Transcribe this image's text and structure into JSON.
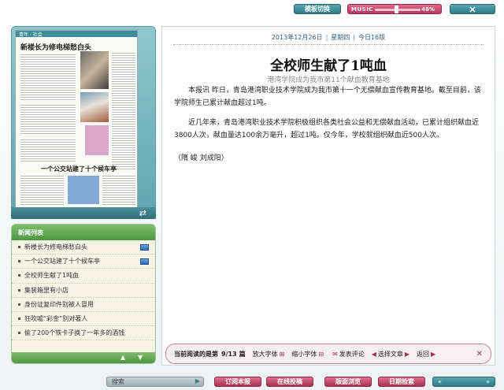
{
  "topbar": {
    "mode_switch_label": "模板切换",
    "music_label": "MUSIC",
    "music_volume": "46%",
    "music_volume_fraction": 0.46
  },
  "thumbnail": {
    "band_label": "青年 · 社会",
    "headline_1": "新楼长为修电梯愁白头",
    "headline_2": "一个公交站建了十个候车亭",
    "refresh_icon": "refresh-icon"
  },
  "news_list": {
    "title": "新闻列表",
    "items": [
      {
        "label": "新楼长为修电梯愁白头",
        "has_image": true
      },
      {
        "label": "一个公交站建了十个候车亭",
        "has_image": true
      },
      {
        "label": "全校师生献了1吨血",
        "has_image": false
      },
      {
        "label": "集装箱里有小店",
        "has_image": false
      },
      {
        "label": "身份证复印件别被人冒用",
        "has_image": false
      },
      {
        "label": "狂吹嘘“彩金”别对著人",
        "has_image": false
      },
      {
        "label": "偷了200个铁卡子换了一年多的酒钱",
        "has_image": false
      }
    ]
  },
  "article": {
    "date": "2013年12月26日",
    "weekday": "星期四",
    "edition": "今日16版",
    "title": "全校师生献了1吨血",
    "subtitle": "港湾学院成为我市第11个献血教育基地",
    "paragraph_1": "本报讯 昨日，青岛港湾职业技术学院成为我市第十一个无偿献血宣传教育基地。截至目前，该学院师生已累计献血超过1吨。",
    "paragraph_2": "近几年来，青岛港湾职业技术学院积极组织各类社会公益和无偿献血活动，已累计组织献血近 3800人次，献血量达100余万毫升，超过1吨。仅今年，学校就组织献血近500人次。",
    "author": "（隋 峻 刘成阳）"
  },
  "reading_bar": {
    "status_label": "当前阅读的是第",
    "current_page": "9/13",
    "page_unit": "篇",
    "enlarge_font": "放大字体",
    "shrink_font": "缩小字体",
    "comment": "发表评论",
    "select_article": "选择文章",
    "back": "返回"
  },
  "bottombar": {
    "search_label": "搜索",
    "subscribe": "订阅本报",
    "submit": "在线投稿",
    "browse": "版面浏览",
    "date_search": "日期检索"
  },
  "colors": {
    "teal": "#2f7d88",
    "pink": "#a8304f",
    "green": "#4d9640"
  }
}
